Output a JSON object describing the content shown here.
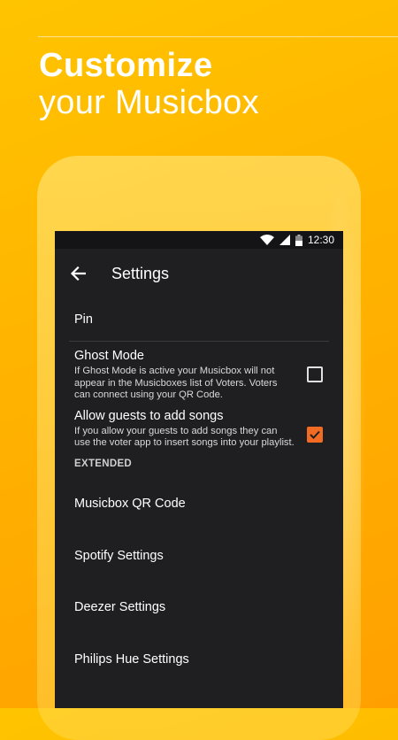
{
  "headline": {
    "line1": "Customize",
    "line2": "your Musicbox"
  },
  "statusbar": {
    "time": "12:30"
  },
  "appbar": {
    "title": "Settings"
  },
  "prefs": {
    "pin": {
      "title": "Pin"
    },
    "ghost_mode": {
      "title": "Ghost Mode",
      "summary": "If Ghost Mode is active your Musicbox will not appear in the Musicboxes list of Voters. Voters can connect using your QR Code.",
      "checked": false
    },
    "allow_guests": {
      "title": "Allow guests to add songs",
      "summary": "If you allow your guests to add songs they can use the voter app to insert songs into your playlist.",
      "checked": true
    }
  },
  "extended": {
    "header": "EXTENDED",
    "items": [
      {
        "label": "Musicbox QR Code"
      },
      {
        "label": "Spotify Settings"
      },
      {
        "label": "Deezer Settings"
      },
      {
        "label": "Philips Hue Settings"
      }
    ]
  },
  "colors": {
    "background": "#ffb300",
    "screen": "#1f1f22",
    "accent": "#f26b22"
  }
}
